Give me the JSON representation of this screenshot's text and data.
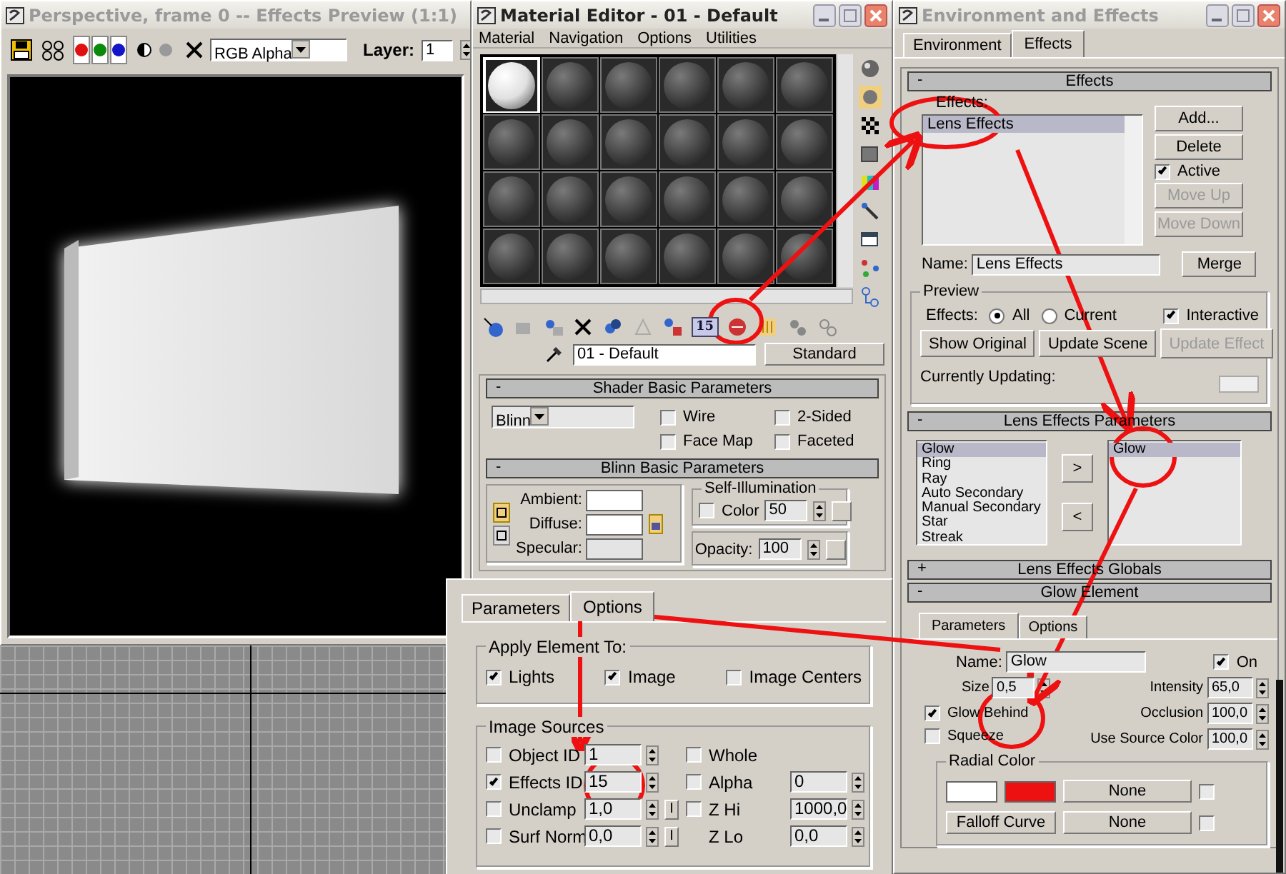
{
  "preview_window": {
    "title": "Perspective, frame 0 -- Effects Preview (1:1)",
    "active": false,
    "toolbar": {
      "channels": [
        {
          "color": "#e01010",
          "on": true
        },
        {
          "color": "#0a8a0a",
          "on": true
        },
        {
          "color": "#1515c8",
          "on": true
        }
      ],
      "display_mode": "RGB Alpha",
      "layer_label": "Layer:",
      "layer_value": "1"
    }
  },
  "material_editor": {
    "title": "Material Editor - 01 - Default",
    "active": true,
    "menu": [
      "Material",
      "Navigation",
      "Options",
      "Utilities"
    ],
    "sample_slots": [
      {
        "selected": true
      },
      {
        "selected": false
      },
      {
        "selected": false
      },
      {
        "selected": false
      },
      {
        "selected": false
      },
      {
        "selected": false
      },
      {
        "selected": false
      },
      {
        "selected": false
      },
      {
        "selected": false
      },
      {
        "selected": false
      },
      {
        "selected": false
      },
      {
        "selected": false
      },
      {
        "selected": false
      },
      {
        "selected": false
      },
      {
        "selected": false
      },
      {
        "selected": false
      },
      {
        "selected": false
      },
      {
        "selected": false
      },
      {
        "selected": false
      },
      {
        "selected": false
      },
      {
        "selected": false
      },
      {
        "selected": false
      },
      {
        "selected": false
      },
      {
        "selected": false
      }
    ],
    "effects_channel_button": "15",
    "material_name": "01 - Default",
    "material_type": "Standard",
    "shader_rollout": {
      "sign": "-",
      "title": "Shader Basic Parameters",
      "shader": "Blinn",
      "options": [
        {
          "label": "Wire",
          "checked": false
        },
        {
          "label": "2-Sided",
          "checked": false
        },
        {
          "label": "Face Map",
          "checked": false
        },
        {
          "label": "Faceted",
          "checked": false
        }
      ]
    },
    "blinn_rollout": {
      "sign": "-",
      "title": "Blinn Basic Parameters",
      "colors": [
        {
          "label": "Ambient:",
          "color": "#ffffff"
        },
        {
          "label": "Diffuse:",
          "color": "#ffffff"
        },
        {
          "label": "Specular:",
          "color": "#e4e4e4"
        }
      ],
      "self_illumination": {
        "title": "Self-Illumination",
        "label": "Color",
        "checked": false,
        "value": "50"
      },
      "opacity_label": "Opacity:",
      "opacity": "100"
    }
  },
  "environment_window": {
    "title": "Environment and Effects",
    "active": false,
    "tabs": [
      {
        "label": "Environment",
        "selected": false
      },
      {
        "label": "Effects",
        "selected": true
      }
    ],
    "effects_rollout": {
      "sign": "-",
      "title": "Effects",
      "list_label": "Effects:",
      "effects": [
        {
          "label": "Lens Effects",
          "selected": true
        }
      ],
      "add_button": "Add...",
      "delete_button": "Delete",
      "active": {
        "label": "Active",
        "checked": true
      },
      "move_up": {
        "label": "Move Up",
        "disabled": true
      },
      "move_down": {
        "label": "Move Down",
        "disabled": true
      },
      "name_label": "Name:",
      "name_value": "Lens Effects",
      "merge_button": "Merge",
      "preview": {
        "title": "Preview",
        "effects_label": "Effects:",
        "modes": [
          {
            "label": "All",
            "selected": true
          },
          {
            "label": "Current",
            "selected": false
          }
        ],
        "interactive": {
          "label": "Interactive",
          "checked": true
        },
        "buttons": [
          {
            "label": "Show Original",
            "disabled": false
          },
          {
            "label": "Update Scene",
            "disabled": false
          }
        ],
        "update_effect": {
          "label": "Update Effect",
          "disabled": true
        },
        "updating_label": "Currently Updating:"
      }
    },
    "lens_rollout": {
      "sign": "-",
      "title": "Lens Effects Parameters",
      "available": [
        {
          "label": "Glow",
          "selected": true
        },
        {
          "label": "Ring",
          "selected": false
        },
        {
          "label": "Ray",
          "selected": false
        },
        {
          "label": "Auto Secondary",
          "selected": false
        },
        {
          "label": "Manual Secondary",
          "selected": false
        },
        {
          "label": "Star",
          "selected": false
        },
        {
          "label": "Streak",
          "selected": false
        }
      ],
      "add_arrow": ">",
      "remove_arrow": "<",
      "active_elements": [
        {
          "label": "Glow",
          "selected": true
        }
      ]
    },
    "globals_rollout": {
      "sign": "+",
      "title": "Lens Effects Globals"
    },
    "glow_rollout": {
      "sign": "-",
      "title": "Glow Element",
      "tabs": [
        {
          "label": "Parameters",
          "selected": true
        },
        {
          "label": "Options",
          "selected": false
        }
      ],
      "name_label": "Name:",
      "name_value": "Glow",
      "on": {
        "label": "On",
        "checked": true
      },
      "size_label": "Size",
      "size": "0,5",
      "params": [
        {
          "label": "Intensity",
          "value": "65,0"
        },
        {
          "label": "Occlusion",
          "value": "100,0"
        },
        {
          "label": "Use Source Color",
          "value": "100,0"
        }
      ],
      "glow_behind": {
        "label": "Glow Behind",
        "checked": true
      },
      "squeeze": {
        "label": "Squeeze",
        "checked": false
      },
      "radial_color": {
        "title": "Radial Color",
        "swatches": [
          {
            "color": "#ffffff"
          },
          {
            "color": "#ee1111"
          }
        ],
        "map_button": "None",
        "map_checked": false,
        "falloff_button": "Falloff Curve",
        "falloff_map": "None",
        "falloff_checked": false
      }
    }
  },
  "options_panel": {
    "tabs": [
      {
        "label": "Parameters",
        "selected": false
      },
      {
        "label": "Options",
        "selected": true
      }
    ],
    "apply": {
      "title": "Apply Element To:",
      "items": [
        {
          "label": "Lights",
          "checked": true
        },
        {
          "label": "Image",
          "checked": true
        },
        {
          "label": "Image Centers",
          "checked": false
        }
      ]
    },
    "sources": {
      "title": "Image Sources",
      "left": [
        {
          "label": "Object ID",
          "checked": false,
          "value": "1"
        },
        {
          "label": "Effects ID",
          "checked": true,
          "value": "15"
        },
        {
          "label": "Unclamp",
          "checked": false,
          "value": "1,0",
          "invert": "I"
        },
        {
          "label": "Surf Norm",
          "checked": false,
          "value": "0,0",
          "invert": "I"
        }
      ],
      "right": [
        {
          "kind": "checkbox",
          "label": "Whole",
          "checked": false
        },
        {
          "kind": "checkbox_value",
          "label": "Alpha",
          "checked": false,
          "value": "0"
        },
        {
          "kind": "checkbox_value",
          "label": "Z Hi",
          "checked": false,
          "value": "1000,0"
        },
        {
          "kind": "value",
          "label": "Z Lo",
          "value": "0,0"
        }
      ]
    }
  }
}
